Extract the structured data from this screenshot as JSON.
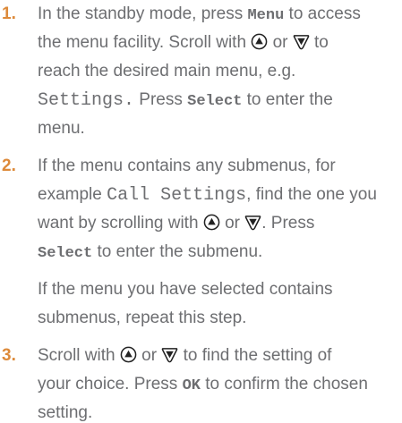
{
  "steps": [
    {
      "number": "1.",
      "lines": [
        {
          "a": "In the standby mode, press ",
          "k1": "Menu",
          "b": " to access"
        },
        {
          "a": "the menu facility. Scroll with ",
          "b": " or ",
          "c": " to"
        },
        {
          "a": "reach the desired main menu, e.g."
        },
        {
          "m": "Settings.",
          "b": " Press ",
          "k1": "Select",
          "c": " to enter the"
        },
        {
          "a": "menu."
        }
      ]
    },
    {
      "number": "2.",
      "lines": [
        {
          "a": "If the menu contains any submenus, for"
        },
        {
          "a": "example ",
          "m": "Call Settings",
          "b": ", find the one you"
        },
        {
          "a": "want by scrolling with ",
          "b": " or ",
          "c": ". Press"
        },
        {
          "k1": "Select",
          "b": " to enter the submenu."
        },
        {
          "a": "If the menu you have selected contains"
        },
        {
          "a": "submenus, repeat this step."
        }
      ]
    },
    {
      "number": "3.",
      "lines": [
        {
          "a": "Scroll with ",
          "b": " or ",
          "c": " to find the setting of"
        },
        {
          "a": "your choice. Press ",
          "k1": "OK",
          "b": " to confirm the chosen"
        },
        {
          "a": "setting."
        }
      ]
    }
  ],
  "icons": {
    "up": "scroll-up-key-icon",
    "down": "scroll-down-key-icon"
  },
  "colors": {
    "number": "#dd8a3a",
    "text": "#6d6e71"
  }
}
